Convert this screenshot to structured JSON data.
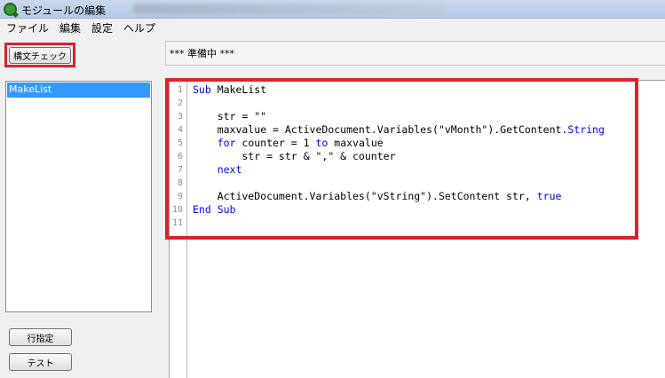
{
  "window": {
    "title": "モジュールの編集"
  },
  "menu": {
    "items": [
      "ファイル",
      "編集",
      "設定",
      "ヘルプ"
    ]
  },
  "toolbar": {
    "syntax_check_label": "構文チェック"
  },
  "status": {
    "text": "*** 準備中 ***"
  },
  "module_list": {
    "items": [
      "MakeList"
    ],
    "selected": "MakeList"
  },
  "buttons": {
    "line_label": "行指定",
    "test_label": "テスト"
  },
  "editor": {
    "line_numbers": [
      "1",
      "2",
      "3",
      "4",
      "5",
      "6",
      "7",
      "8",
      "9",
      "10",
      "11"
    ],
    "lines": [
      [
        {
          "t": "Sub",
          "k": true
        },
        {
          "t": " MakeList"
        }
      ],
      [],
      [
        {
          "t": "    str = \"\""
        }
      ],
      [
        {
          "t": "    maxvalue = ActiveDocument.Variables(\"vMonth\").GetContent."
        },
        {
          "t": "String",
          "k": true
        }
      ],
      [
        {
          "t": "    "
        },
        {
          "t": "for",
          "k": true
        },
        {
          "t": " counter = 1 "
        },
        {
          "t": "to",
          "k": true
        },
        {
          "t": " maxvalue"
        }
      ],
      [
        {
          "t": "        str = str & \",\" & counter"
        }
      ],
      [
        {
          "t": "    "
        },
        {
          "t": "next",
          "k": true
        }
      ],
      [],
      [
        {
          "t": "    ActiveDocument.Variables(\"vString\").SetContent str, "
        },
        {
          "t": "true",
          "k": true
        }
      ],
      [
        {
          "t": "End Sub",
          "k": true
        }
      ],
      []
    ]
  },
  "colors": {
    "highlight": "#e0202a",
    "keyword": "#0000ff",
    "selection": "#3399ff"
  }
}
